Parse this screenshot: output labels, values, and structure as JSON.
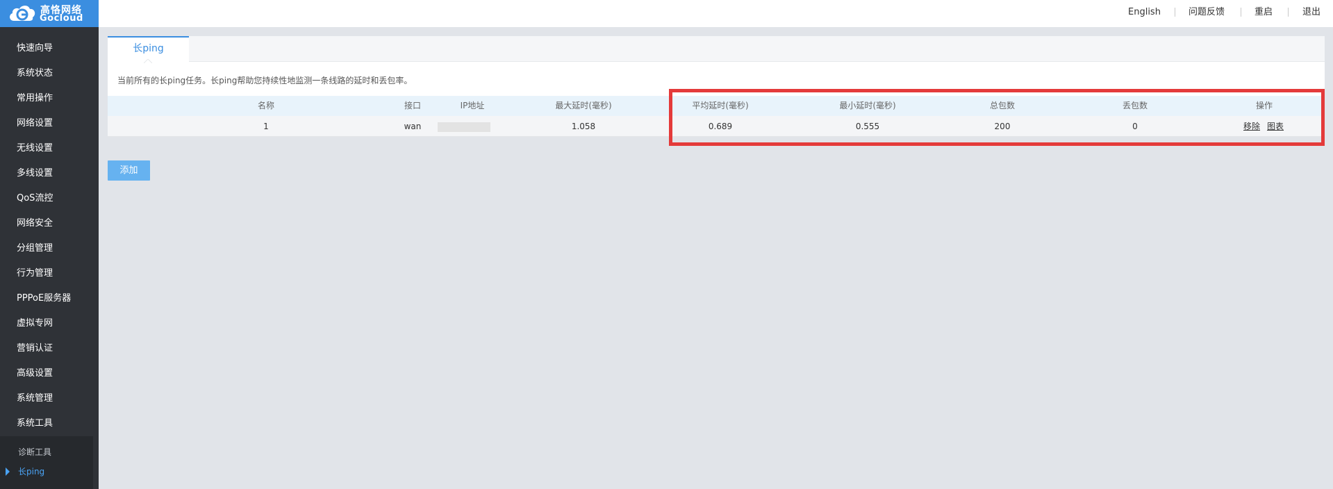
{
  "brand": {
    "name_cn": "高恪网络",
    "name_en": "Gocloud"
  },
  "sidebar": {
    "items": [
      {
        "label": "快速向导"
      },
      {
        "label": "系统状态"
      },
      {
        "label": "常用操作"
      },
      {
        "label": "网络设置"
      },
      {
        "label": "无线设置"
      },
      {
        "label": "多线设置"
      },
      {
        "label": "QoS流控"
      },
      {
        "label": "网络安全"
      },
      {
        "label": "分组管理"
      },
      {
        "label": "行为管理"
      },
      {
        "label": "PPPoE服务器"
      },
      {
        "label": "虚拟专网"
      },
      {
        "label": "营销认证"
      },
      {
        "label": "高级设置"
      },
      {
        "label": "系统管理"
      },
      {
        "label": "系统工具"
      }
    ],
    "submenu": [
      {
        "label": "诊断工具"
      },
      {
        "label": "长ping"
      }
    ]
  },
  "topbar": {
    "english": "English",
    "feedback": "问题反馈",
    "reboot": "重启",
    "logout": "退出"
  },
  "main": {
    "tab_label": "长ping",
    "description": "当前所有的长ping任务。长ping帮助您持续性地监测一条线路的延时和丢包率。",
    "table": {
      "headers": [
        "名称",
        "接口",
        "IP地址",
        "最大延时(毫秒)",
        "平均延时(毫秒)",
        "最小延时(毫秒)",
        "总包数",
        "丢包数",
        "操作"
      ],
      "rows": [
        {
          "name": "1",
          "interface": "wan",
          "max_delay": "1.058",
          "avg_delay": "0.689",
          "min_delay": "0.555",
          "total": "200",
          "lost": "0",
          "remove_label": "移除",
          "chart_label": "图表"
        }
      ]
    },
    "add_button": "添加"
  },
  "colors": {
    "sidebar_bg": "#2f3237",
    "accent": "#3b8ee0",
    "highlight_box": "#e43a3a",
    "add_button": "#66b2f0"
  }
}
